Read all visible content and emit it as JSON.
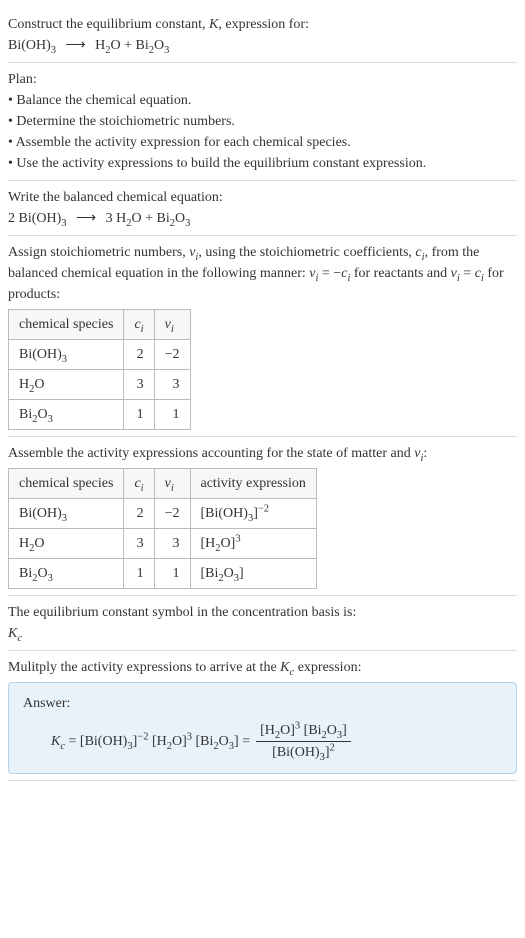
{
  "title_line1": "Construct the equilibrium constant, K, expression for:",
  "eq_unbalanced": "Bi(OH)₃ ⟶ H₂O + Bi₂O₃",
  "plan_heading": "Plan:",
  "plan_items": [
    "• Balance the chemical equation.",
    "• Determine the stoichiometric numbers.",
    "• Assemble the activity expression for each chemical species.",
    "• Use the activity expressions to build the equilibrium constant expression."
  ],
  "balanced_heading": "Write the balanced chemical equation:",
  "eq_balanced": "2 Bi(OH)₃ ⟶ 3 H₂O + Bi₂O₃",
  "stoich_text1": "Assign stoichiometric numbers, νᵢ, using the stoichiometric coefficients, cᵢ, from the balanced chemical equation in the following manner: νᵢ = −cᵢ for reactants and νᵢ = cᵢ for products:",
  "table1": {
    "headers": [
      "chemical species",
      "cᵢ",
      "νᵢ"
    ],
    "rows": [
      [
        "Bi(OH)₃",
        "2",
        "−2"
      ],
      [
        "H₂O",
        "3",
        "3"
      ],
      [
        "Bi₂O₃",
        "1",
        "1"
      ]
    ]
  },
  "activity_heading": "Assemble the activity expressions accounting for the state of matter and νᵢ:",
  "table2": {
    "headers": [
      "chemical species",
      "cᵢ",
      "νᵢ",
      "activity expression"
    ],
    "rows": [
      [
        "Bi(OH)₃",
        "2",
        "−2",
        "[Bi(OH)₃]⁻²"
      ],
      [
        "H₂O",
        "3",
        "3",
        "[H₂O]³"
      ],
      [
        "Bi₂O₃",
        "1",
        "1",
        "[Bi₂O₃]"
      ]
    ]
  },
  "kc_symbol_text": "The equilibrium constant symbol in the concentration basis is:",
  "kc_symbol": "K꜀",
  "multiply_text": "Mulitply the activity expressions to arrive at the K꜀ expression:",
  "answer_label": "Answer:",
  "answer_lhs": "K꜀ = [Bi(OH)₃]⁻² [H₂O]³ [Bi₂O₃] =",
  "answer_frac_top": "[H₂O]³ [Bi₂O₃]",
  "answer_frac_bot": "[Bi(OH)₃]²"
}
